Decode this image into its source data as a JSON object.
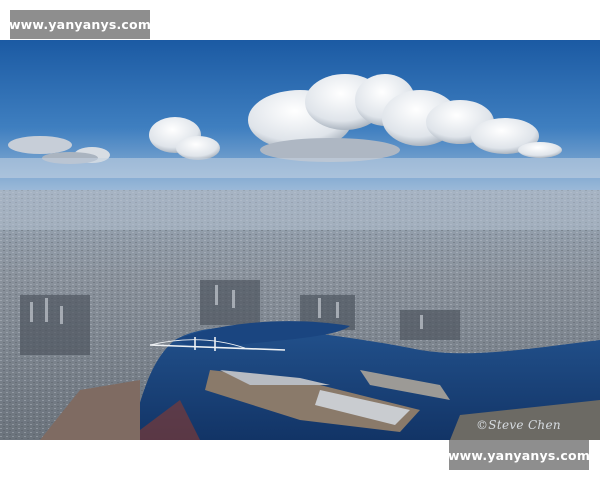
{
  "watermark": {
    "top_text": "www.yanyanys.com",
    "bottom_text": "www.yanyanys.com"
  },
  "photo": {
    "subject": "aerial-city-bay-view",
    "signature": "©Steve Chen",
    "colors": {
      "sky_top": "#1d5fa8",
      "sky_horizon": "#8fb1d2",
      "city": "#7d8792",
      "water": "#173f79",
      "cloud": "#eef1f4"
    }
  }
}
